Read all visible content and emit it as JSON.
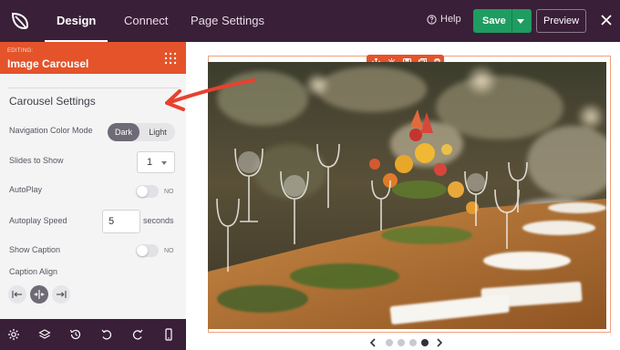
{
  "header": {
    "tabs": [
      {
        "label": "Design",
        "active": true
      },
      {
        "label": "Connect",
        "active": false
      },
      {
        "label": "Page Settings",
        "active": false
      }
    ],
    "help_label": "Help",
    "save_label": "Save",
    "preview_label": "Preview",
    "icons": [
      "seedprod-leaf-logo-icon",
      "help-circle-icon",
      "save-dropdown-chevron-icon",
      "close-icon"
    ]
  },
  "sidebar": {
    "editing_label": "EDITING:",
    "title": "Image Carousel",
    "section_title": "Carousel Settings",
    "navigation_color_mode": {
      "label": "Navigation Color Mode",
      "options": [
        "Dark",
        "Light"
      ],
      "selected": "Dark"
    },
    "slides_to_show": {
      "label": "Slides to Show",
      "value": "1"
    },
    "autoplay": {
      "label": "AutoPlay",
      "state": "NO"
    },
    "autoplay_speed": {
      "label": "Autoplay Speed",
      "value": "5",
      "unit": "seconds"
    },
    "show_caption": {
      "label": "Show Caption",
      "state": "NO"
    },
    "caption_align": {
      "label": "Caption Align",
      "options": [
        "left",
        "center",
        "right"
      ],
      "selected": "center"
    }
  },
  "bottombar": {
    "icons": [
      "settings-gear-icon",
      "layers-icon",
      "history-icon",
      "undo-icon",
      "redo-icon",
      "mobile-preview-icon"
    ]
  },
  "canvas": {
    "block_toolbar_icons": [
      "move-icon",
      "block-settings-icon",
      "save-block-icon",
      "duplicate-icon",
      "delete-icon"
    ],
    "slides_total": 4,
    "active_slide": 4
  },
  "colors": {
    "topbar": "#3a1f38",
    "editing_header": "#e4532a",
    "save_button": "#1e9c61",
    "annotation_arrow": "#e8412f"
  }
}
